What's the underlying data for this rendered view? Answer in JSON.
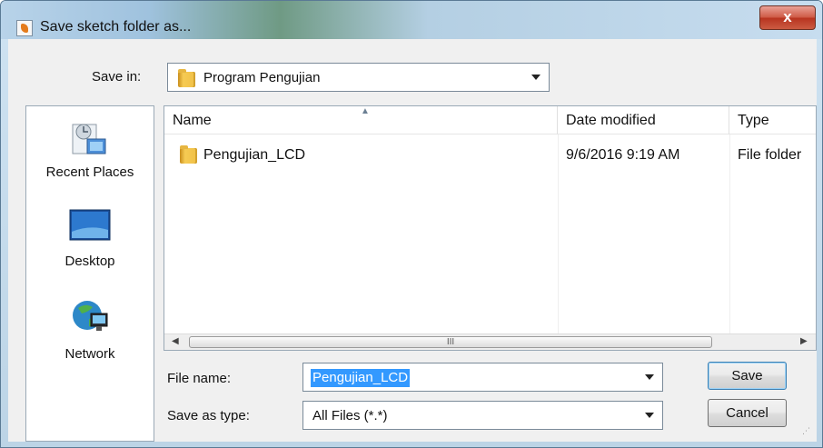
{
  "window": {
    "title": "Save sketch folder as...",
    "close_label": "x"
  },
  "save_in": {
    "label": "Save in:",
    "value": "Program Pengujian"
  },
  "places": [
    {
      "label": "Recent Places",
      "icon": "recent-places-icon"
    },
    {
      "label": "Desktop",
      "icon": "desktop-icon"
    },
    {
      "label": "Network",
      "icon": "network-icon"
    }
  ],
  "file_list": {
    "columns": [
      "Name",
      "Date modified",
      "Type"
    ],
    "rows": [
      {
        "name": "Pengujian_LCD",
        "date": "9/6/2016 9:19 AM",
        "type": "File folder",
        "icon": "folder-icon"
      }
    ],
    "scroll_thumb_label": "III"
  },
  "file_name": {
    "label": "File name:",
    "value": "Pengujian_LCD"
  },
  "save_type": {
    "label": "Save as type:",
    "value": "All Files (*.*)"
  },
  "buttons": {
    "save": "Save",
    "cancel": "Cancel"
  },
  "colors": {
    "selection": "#3399ff",
    "title_close": "#c9443a",
    "folder": "#f0c047"
  }
}
